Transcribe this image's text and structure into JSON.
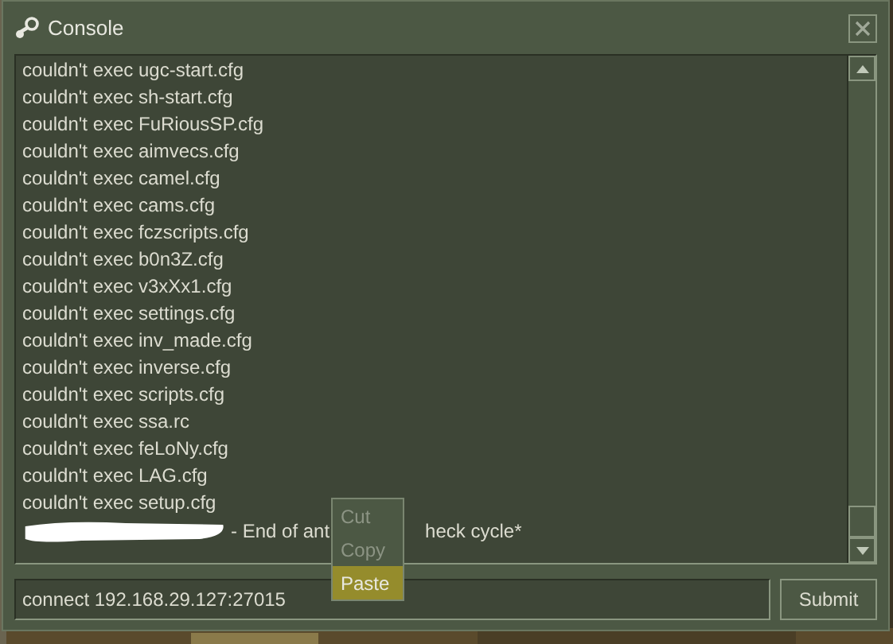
{
  "window": {
    "title": "Console"
  },
  "log": {
    "lines": [
      "couldn't exec ugc-start.cfg",
      "couldn't exec sh-start.cfg",
      "couldn't exec FuRiousSP.cfg",
      "couldn't exec aimvecs.cfg",
      "couldn't exec camel.cfg",
      "couldn't exec cams.cfg",
      "couldn't exec fczscripts.cfg",
      "couldn't exec b0n3Z.cfg",
      "couldn't exec v3xXx1.cfg",
      "couldn't exec settings.cfg",
      "couldn't exec inv_made.cfg",
      "couldn't exec inverse.cfg",
      "couldn't exec scripts.cfg",
      "couldn't exec ssa.rc",
      "couldn't exec feLoNy.cfg",
      "couldn't exec LAG.cfg",
      "couldn't exec setup.cfg"
    ],
    "last_line": {
      "redacted": true,
      "parts": [
        "- End of ant",
        "heck cycle*"
      ]
    }
  },
  "context_menu": {
    "items": [
      {
        "label": "Cut",
        "disabled": true,
        "selected": false
      },
      {
        "label": "Copy",
        "disabled": true,
        "selected": false
      },
      {
        "label": "Paste",
        "disabled": false,
        "selected": true
      }
    ]
  },
  "command": {
    "value": "connect 192.168.29.127:27015"
  },
  "submit_button": {
    "label": "Submit"
  }
}
